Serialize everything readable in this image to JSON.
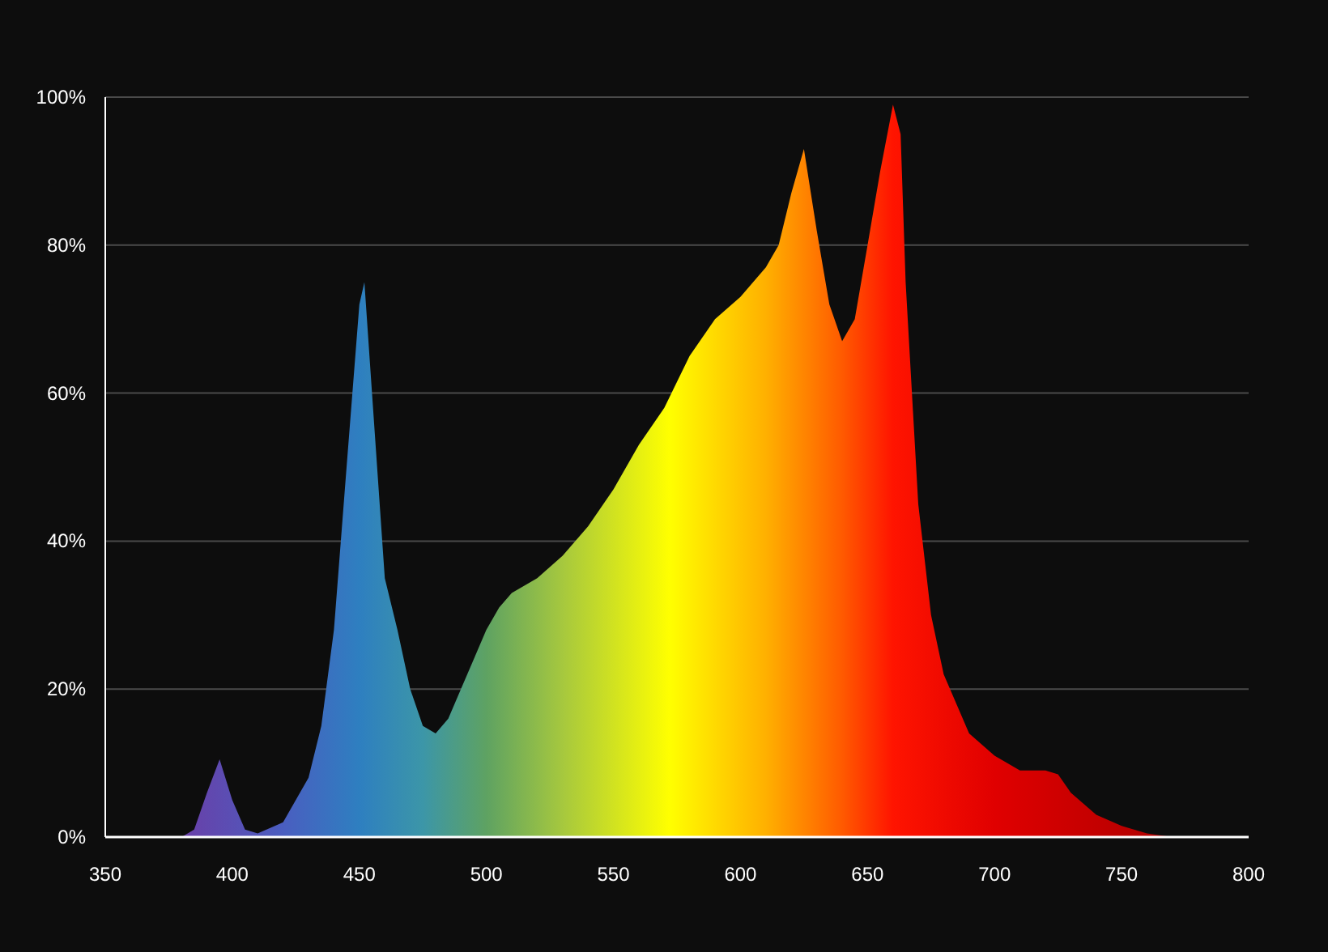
{
  "chart_data": {
    "type": "area",
    "x": [
      350,
      380,
      385,
      390,
      395,
      400,
      405,
      410,
      420,
      430,
      435,
      440,
      445,
      450,
      452,
      455,
      460,
      465,
      470,
      475,
      480,
      485,
      490,
      495,
      500,
      505,
      510,
      520,
      530,
      540,
      550,
      560,
      570,
      580,
      590,
      600,
      610,
      615,
      620,
      625,
      630,
      635,
      640,
      645,
      650,
      655,
      660,
      663,
      665,
      670,
      675,
      680,
      690,
      700,
      710,
      720,
      725,
      730,
      740,
      750,
      760,
      770,
      800
    ],
    "values": [
      0,
      0,
      1,
      6,
      10.5,
      5,
      1,
      0.5,
      2,
      8,
      15,
      28,
      50,
      72,
      75,
      60,
      35,
      28,
      20,
      15,
      14,
      16,
      20,
      24,
      28,
      31,
      33,
      35,
      38,
      42,
      47,
      53,
      58,
      65,
      70,
      73,
      77,
      80,
      87,
      93,
      82,
      72,
      67,
      70,
      80,
      90,
      99,
      95,
      75,
      45,
      30,
      22,
      14,
      11,
      9,
      9,
      8.5,
      6,
      3,
      1.5,
      0.5,
      0,
      0
    ],
    "grid": true,
    "xlim": [
      350,
      800
    ],
    "ylim": [
      0,
      100
    ],
    "xticks": [
      350,
      400,
      450,
      500,
      550,
      600,
      650,
      700,
      750,
      800
    ],
    "yticks": [
      {
        "value": 0,
        "label": "0%"
      },
      {
        "value": 20,
        "label": "20%"
      },
      {
        "value": 40,
        "label": "40%"
      },
      {
        "value": 60,
        "label": "60%"
      },
      {
        "value": 80,
        "label": "80%"
      },
      {
        "value": 100,
        "label": "100%"
      }
    ]
  }
}
